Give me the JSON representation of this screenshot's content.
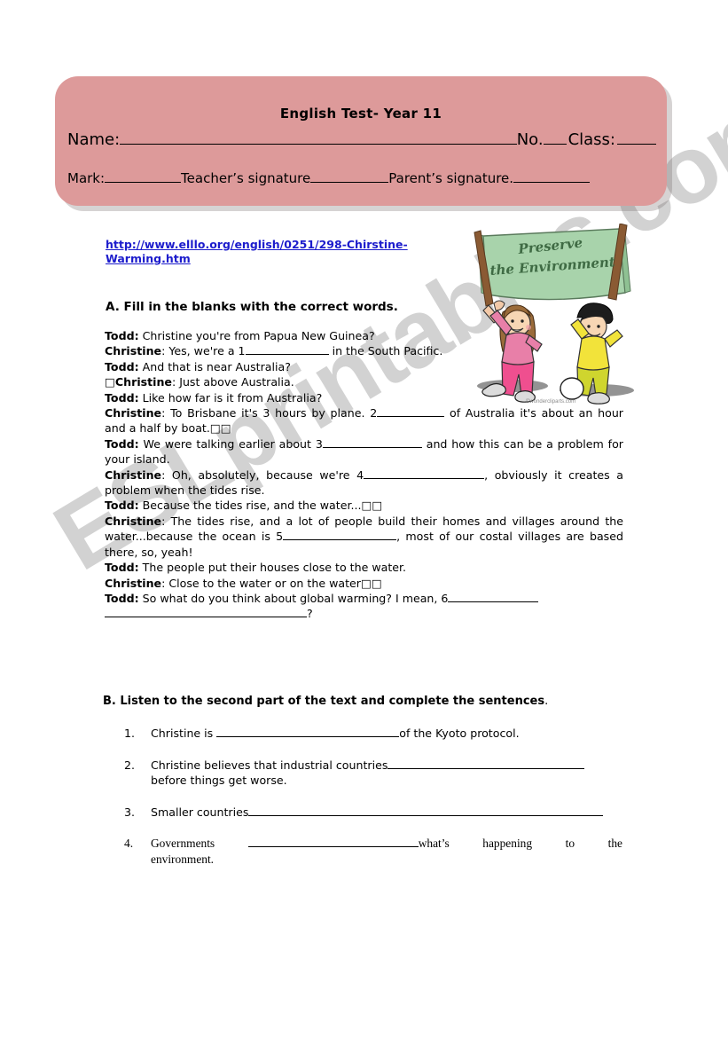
{
  "watermark": {
    "text": "ESLprintables.com",
    "color": "#d2d2d2"
  },
  "header": {
    "title": "English Test-  Year 11",
    "name_label": "Name:",
    "no_label": "No.",
    "class_label": "Class:",
    "mark_label": "Mark:",
    "teacher_label": "Teacher’s signature",
    "parent_label": "Parent’s signature.",
    "background_color": "#dd9a9a"
  },
  "link": {
    "url_text": "http://www.elllo.org/english/0251/298-Chirstine-Warming.htm",
    "color": "#1c1ccc"
  },
  "clipart": {
    "banner_line1": "Preserve",
    "banner_line2": "the Environment",
    "credit": "©wondercliparts.com",
    "banner_color": "#a8d3ab"
  },
  "section_a": {
    "heading": "A.  Fill in the blanks with the correct words.",
    "lines": [
      {
        "speaker": "Todd:",
        "text": " Christine you're from Papua New Guinea?"
      },
      {
        "speaker": "Christine",
        "text": ": Yes, we're a 1",
        "blank": 1,
        "after": " in the South Pacific."
      },
      {
        "speaker": "Todd:",
        "text": " And that is near Australia?"
      },
      {
        "speaker": "□Christine",
        "text": ": Just above Australia."
      },
      {
        "speaker": "Todd:",
        "text": " Like how far is it from Australia?"
      },
      {
        "speaker": "Christine",
        "text": ": To Brisbane it's 3 hours by plane. 2",
        "blank": 2,
        "after": " of Australia it's about an hour and a half by boat.□□"
      },
      {
        "speaker": "Todd:",
        "text": " We were talking earlier about 3",
        "blank": 3,
        "after": " and how this can be a problem for your island."
      },
      {
        "speaker": "Christine",
        "text": ": Oh, absolutely, because we're 4",
        "blank": 4,
        "after": ", obviously it creates a problem when the tides rise."
      },
      {
        "speaker": "Todd:",
        "text": " Because the tides rise, and the water...□□"
      },
      {
        "speaker": "Christine",
        "text": ": The tides rise, and a lot of people build their homes and villages around the water...because the ocean is 5",
        "blank": 5,
        "after": ", most of our costal villages are based there, so, yeah!"
      },
      {
        "speaker": "Todd:",
        "text": " The people put their houses close to the water."
      },
      {
        "speaker": "Christine",
        "text": ": Close to the water or on the water□□"
      },
      {
        "speaker": "Todd:",
        "text": " So what do you think about global warming? I mean, 6",
        "blank": 6,
        "after": "?"
      }
    ]
  },
  "section_b": {
    "heading_bold": "B. Listen to the second part of the text and complete the sentences",
    "heading_tail": ".",
    "items": [
      {
        "num": "1.",
        "before": "Christine is ",
        "after": "of the Kyoto protocol."
      },
      {
        "num": "2.",
        "before": "Christine believes that industrial countries",
        "after": "before things get worse."
      },
      {
        "num": "3.",
        "before": "Smaller countries",
        "after": ""
      },
      {
        "num": "4.",
        "before": "Governments",
        "mid": "what’s",
        "mid2": "happening",
        "mid3": "to",
        "mid4": "the",
        "after": "environment."
      }
    ]
  }
}
